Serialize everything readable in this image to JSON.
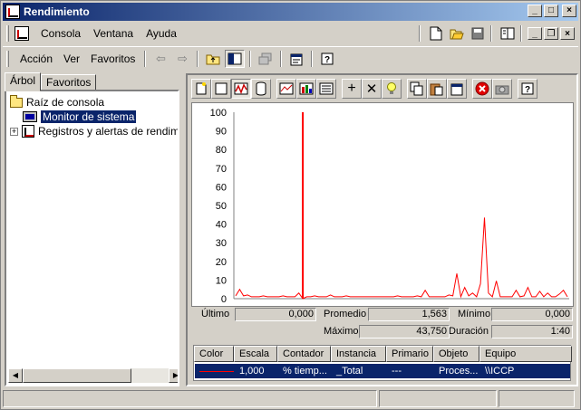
{
  "window": {
    "title": "Rendimiento",
    "controls": {
      "minimize": "_",
      "maximize": "□",
      "close": "×"
    }
  },
  "menubar": {
    "items": [
      "Consola",
      "Ventana",
      "Ayuda"
    ],
    "mdi_controls": {
      "minimize": "_",
      "restore": "❐",
      "close": "×"
    }
  },
  "toolbar": {
    "items": [
      "Acción",
      "Ver",
      "Favoritos"
    ]
  },
  "leftpane": {
    "tabs": [
      "Árbol",
      "Favoritos"
    ],
    "tree": {
      "root": "Raíz de consola",
      "items": [
        "Monitor de sistema",
        "Registros y alertas de rendimiento"
      ]
    }
  },
  "chart_data": {
    "type": "line",
    "ylim": [
      0,
      100
    ],
    "yticks": [
      0,
      10,
      20,
      30,
      40,
      50,
      60,
      70,
      80,
      90,
      100
    ],
    "grid": false,
    "cursor_index": 17,
    "series": [
      {
        "color": "#ff0000",
        "values": [
          1.5,
          5,
          1.5,
          2,
          1,
          1,
          1,
          1.5,
          1,
          1,
          1,
          1,
          1.5,
          1,
          1,
          1,
          3,
          0,
          1,
          1,
          1.5,
          1,
          1,
          1,
          2,
          1,
          1,
          1,
          1.5,
          1,
          1,
          1,
          1,
          1,
          1,
          1,
          1,
          1,
          1,
          1,
          1,
          1.5,
          1,
          1,
          1,
          1,
          1.5,
          1,
          4.5,
          1,
          1,
          1,
          1,
          1,
          2,
          1.5,
          13.5,
          1,
          6,
          1.5,
          3,
          1,
          8,
          43.5,
          3,
          1,
          9.5,
          1,
          1,
          1,
          1,
          4.5,
          1,
          1.5,
          6,
          1,
          1,
          4,
          1,
          3,
          1,
          1,
          2.5,
          4.5,
          1
        ]
      }
    ]
  },
  "stats": {
    "ultimo_label": "Último",
    "ultimo": "0,000",
    "promedio_label": "Promedio",
    "promedio": "1,563",
    "minimo_label": "Mínimo",
    "minimo": "0,000",
    "maximo_label": "Máximo",
    "maximo": "43,750",
    "duracion_label": "Duración",
    "duracion": "1:40"
  },
  "legend": {
    "headers": [
      "Color",
      "Escala",
      "Contador",
      "Instancia",
      "Primario",
      "Objeto",
      "Equipo"
    ],
    "row": {
      "scale": "1,000",
      "counter": "% tiemp...",
      "instance": "_Total",
      "parent": "---",
      "object": "Proces...",
      "computer": "\\\\ICCP"
    }
  }
}
